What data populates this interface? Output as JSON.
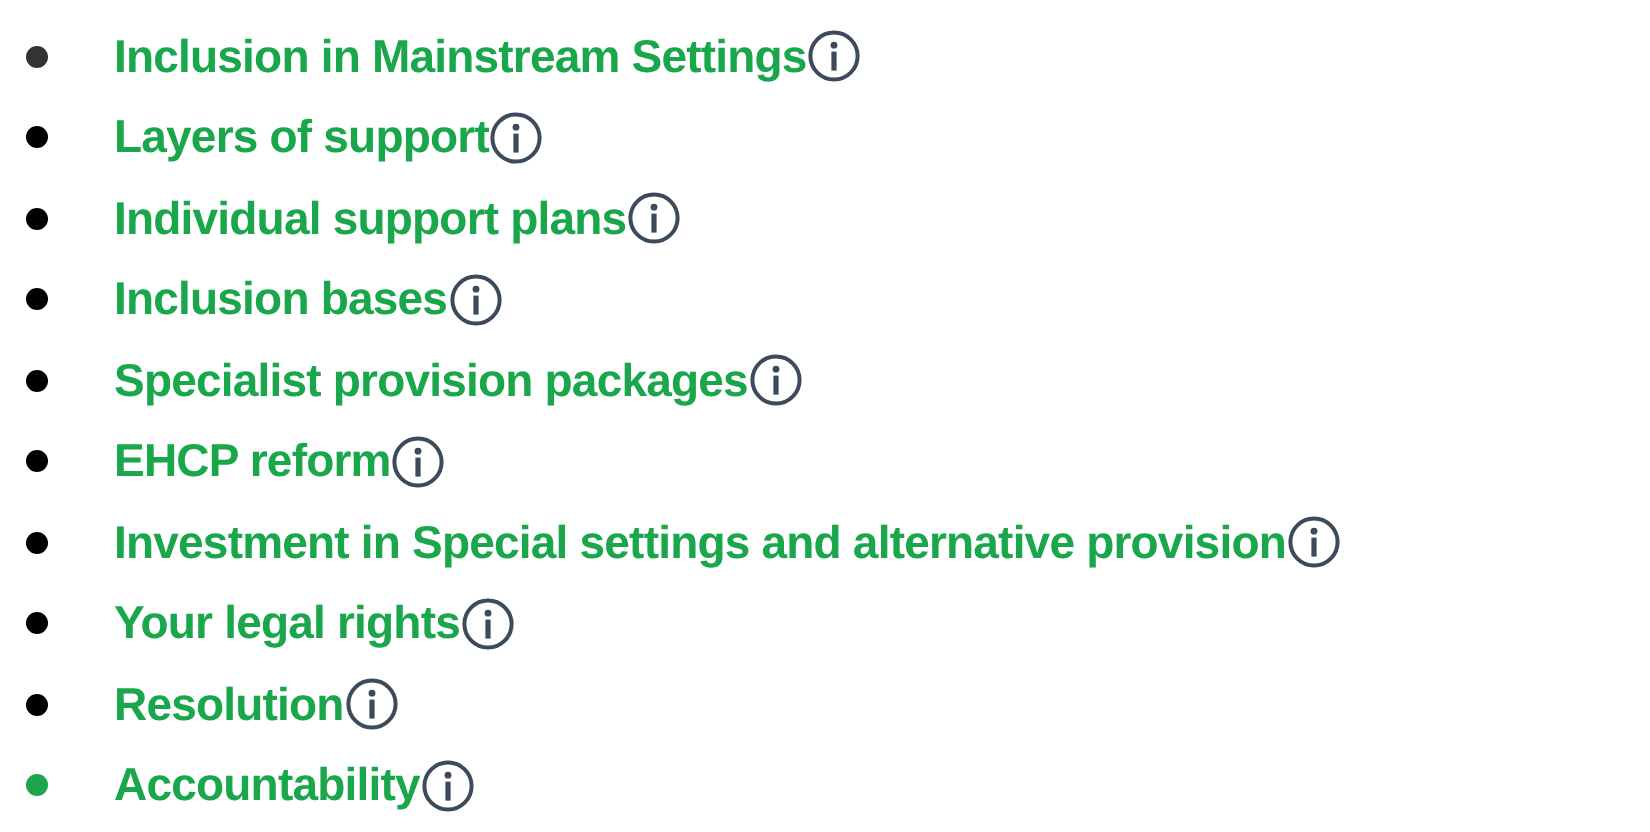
{
  "items": [
    {
      "label": "Inclusion in Mainstream Settings",
      "color": "#333333"
    },
    {
      "label": "Layers of support",
      "color": "#000000"
    },
    {
      "label": "Individual support plans",
      "color": "#000000"
    },
    {
      "label": "Inclusion bases",
      "color": "#000000"
    },
    {
      "label": "Specialist provision packages",
      "color": "#000000"
    },
    {
      "label": "EHCP reform",
      "color": "#000000"
    },
    {
      "label": "Investment in Special settings and alternative provision",
      "color": "#000000"
    },
    {
      "label": "Your legal rights",
      "color": "#000000"
    },
    {
      "label": "Resolution",
      "color": "#000000"
    },
    {
      "label": "Accountability",
      "color": "#1aa64a"
    }
  ]
}
